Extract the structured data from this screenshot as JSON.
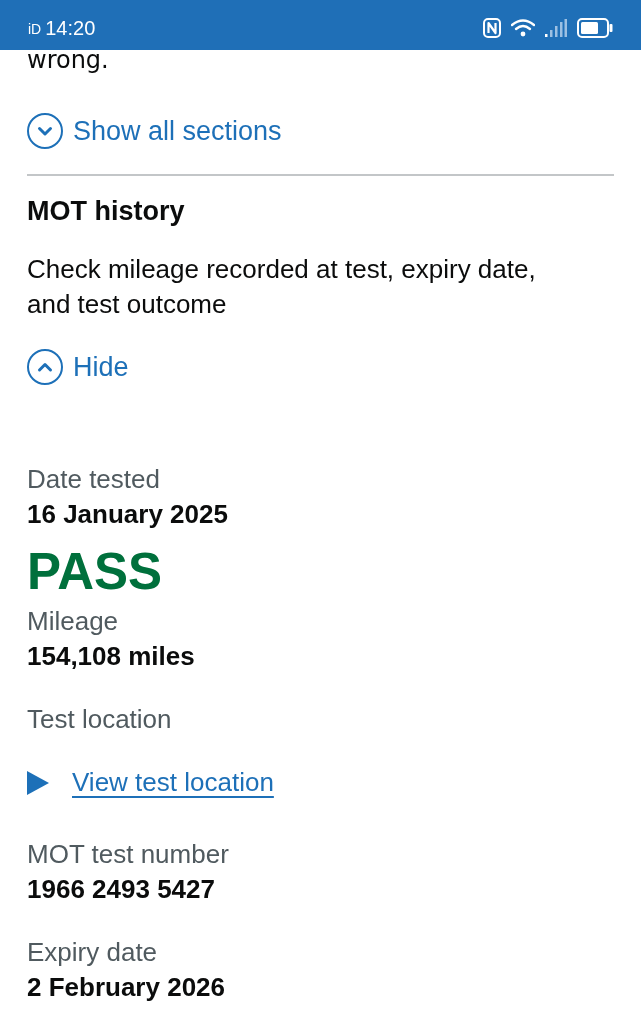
{
  "status_bar": {
    "carrier": "iD",
    "time": "14:20"
  },
  "page": {
    "intro_tail": "wrong.",
    "show_all": {
      "label": "Show all sections",
      "expanded": false
    },
    "section": {
      "title": "MOT history",
      "summary": "Check mileage recorded at test, expiry date, and test outcome",
      "toggle": {
        "label": "Hide",
        "expanded": true
      }
    },
    "test": [
      {
        "kind": "field",
        "label": "Date tested",
        "value": "16 January 2025"
      },
      {
        "kind": "outcome",
        "passed": true,
        "text": "PASS"
      },
      {
        "kind": "field",
        "label": "Mileage",
        "value": "154,108 miles"
      },
      {
        "kind": "details",
        "label": "Test location",
        "summary": "View test location",
        "expanded": false
      },
      {
        "kind": "field",
        "label": "MOT test number",
        "value": "1966 2493 5427"
      },
      {
        "kind": "field",
        "label": "Expiry date",
        "value": "2 February 2026"
      }
    ]
  }
}
